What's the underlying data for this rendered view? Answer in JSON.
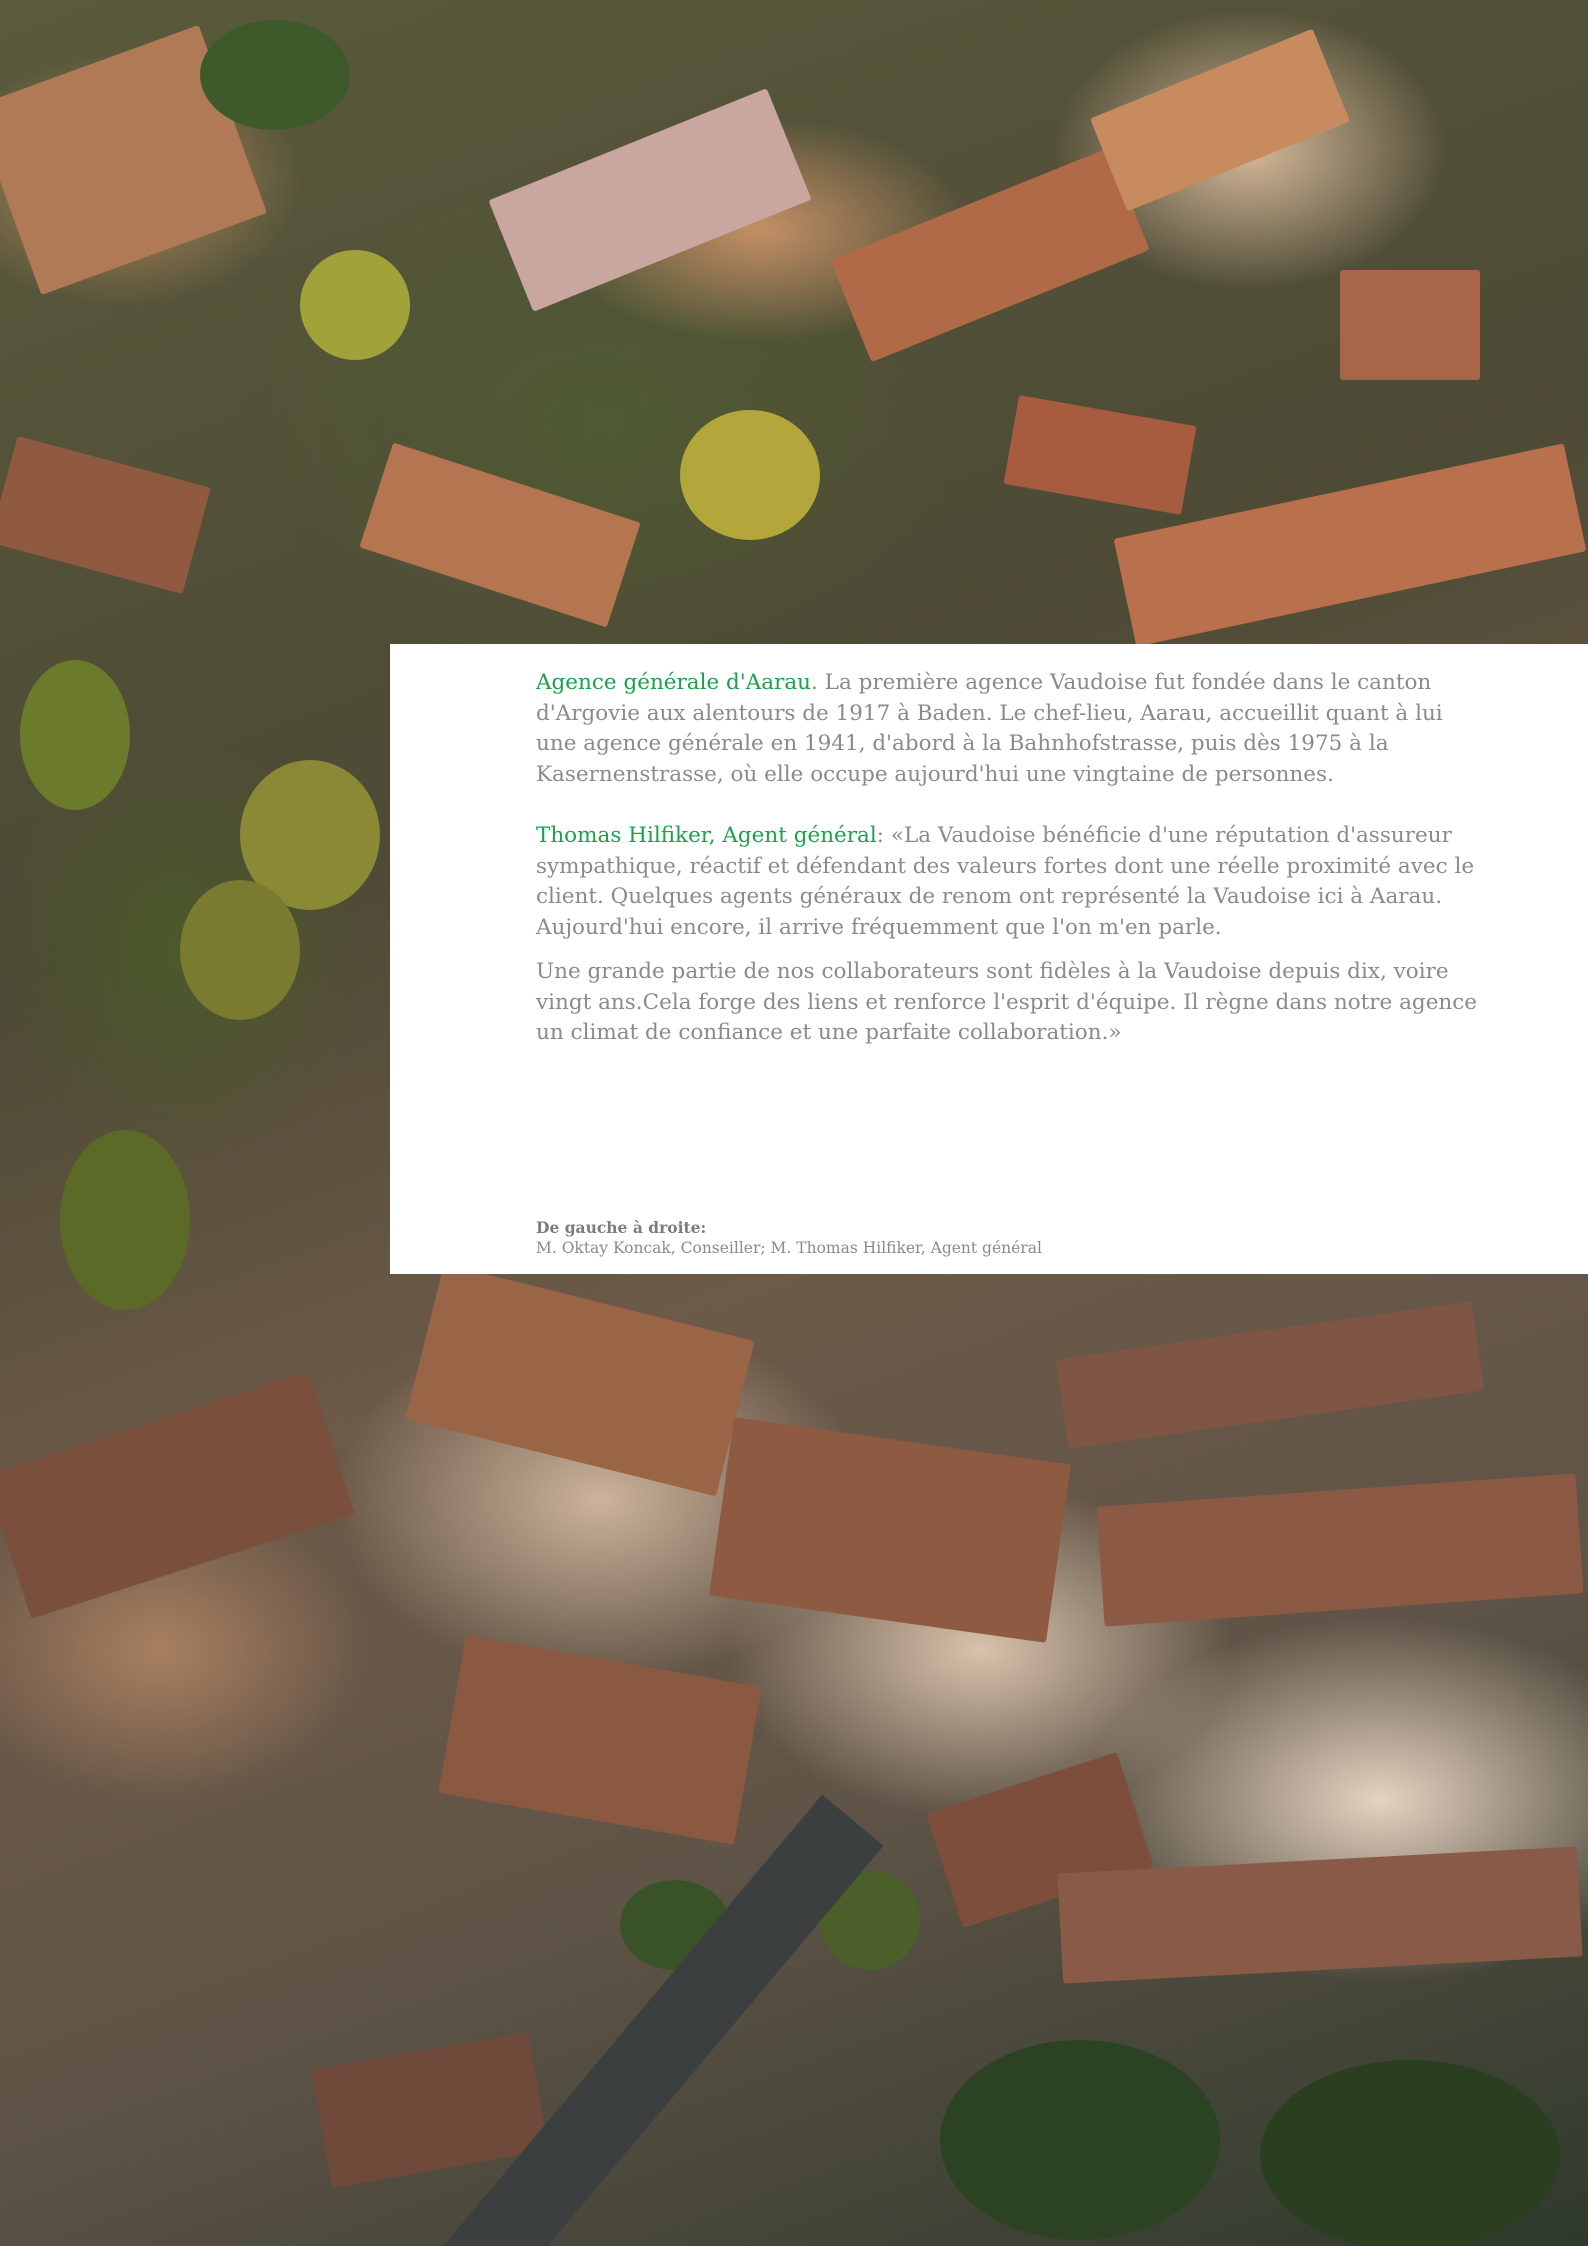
{
  "section1": {
    "heading": "Agence générale d'Aarau",
    "body": ". La première agence Vaudoise fut fondée dans le canton d'Argovie aux alentours de 1917 à Baden. Le chef-lieu, Aarau, accueillit quant à lui une agence générale en 1941, d'abord à la Bahnhofstrasse, puis dès 1975 à la Kasernenstrasse, où elle occupe aujourd'hui une vingtaine de personnes."
  },
  "section2": {
    "heading": "Thomas Hilfiker, Agent général",
    "body": ": «La Vaudoise bénéficie d'une réputation d'assureur sympathique, réactif et défendant des valeurs fortes dont une réelle proximité avec le client. Quelques agents généraux de renom ont représenté la Vaudoise ici à Aarau. Aujourd'hui encore, il arrive fréquemment que l'on m'en parle.",
    "body2": "Une grande partie de nos collaborateurs sont fidèles à la Vaudoise depuis dix, voire vingt ans.Cela forge des liens et renforce l'esprit d'équipe. Il règne dans notre agence un climat de confiance et une parfaite collaboration.»"
  },
  "caption": {
    "title": "De gauche à droite:",
    "text": "M. Oktay Koncak, Conseiller; M. Thomas Hilfiker, Agent général"
  }
}
